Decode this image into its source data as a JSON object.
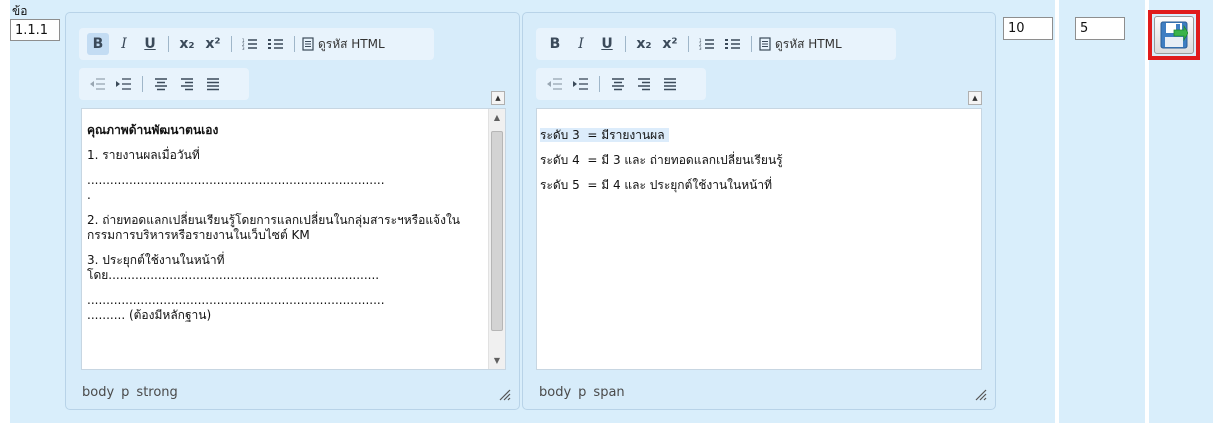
{
  "row": {
    "label": "ข้อ",
    "item_value": "1.1.1"
  },
  "toolbar": {
    "bold": "B",
    "italic": "I",
    "underline": "U",
    "subscript": "x₂",
    "superscript": "x²",
    "view_html": "ดูรหัส HTML"
  },
  "editor_left": {
    "heading": "คุณภาพด้านพัฒนาตนเอง",
    "lines": [
      "1. รายงานผลเมื่อวันที่",
      "..............................................................................\n.",
      "2. ถ่ายทอดแลกเปลี่ยนเรียนรู้โดยการแลกเปลี่ยนในกลุ่มสาระฯหรือแจ้งในกรรมการบริหารหรือรายงานในเว็บไซต์ KM",
      "3. ประยุกต์ใช้งานในหน้าที่\nโดย.......................................................................",
      "..............................................................................\n.......... (ต้องมีหลักฐาน)"
    ],
    "path": [
      "body",
      "p",
      "strong"
    ]
  },
  "editor_right": {
    "lines": [
      "ระดับ 3  = มีรายงานผล",
      "ระดับ 4  = มี 3 และ ถ่ายทอดแลกเปลี่ยนเรียนรู้",
      "ระดับ 5  = มี 4 และ ประยุกต์ใช้งานในหน้าที่"
    ],
    "path": [
      "body",
      "p",
      "span"
    ]
  },
  "fields": {
    "score_max": "10",
    "score_value": "5"
  },
  "colors": {
    "column_bg": "#d9eefb",
    "highlight_red": "#e01b1b"
  }
}
